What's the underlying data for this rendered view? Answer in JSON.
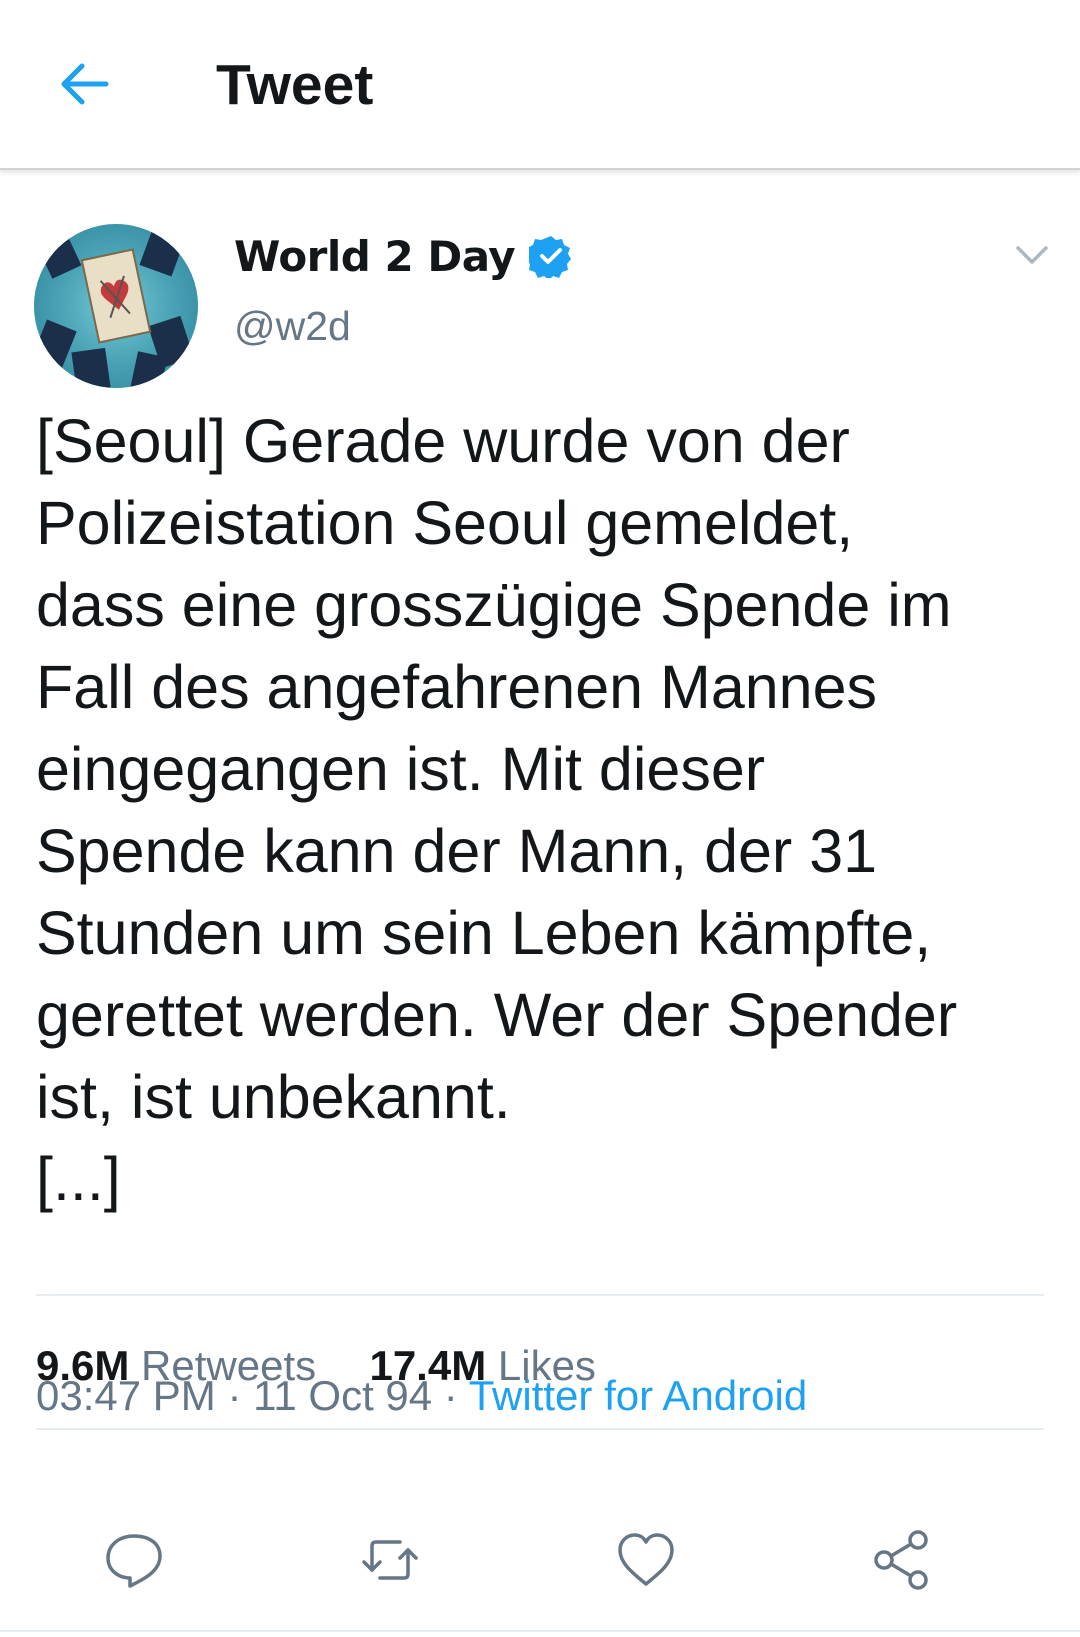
{
  "header": {
    "title": "Tweet",
    "back_icon": "arrow-left-icon"
  },
  "tweet": {
    "author_name": "World 2 Day",
    "author_handle": "@w2d",
    "verified": true,
    "text": "[Seoul] Gerade wurde von der\nPolizeistation Seoul gemeldet,\ndass eine grosszügige Spende im\nFall des angefahrenen Mannes\neingegangen ist. Mit dieser\nSpende kann der Mann, der 31\nStunden um sein Leben kämpfte,\ngerettet werden. Wer der Spender\nist, ist unbekannt.\n[...]",
    "time": "03:47 PM",
    "separator": "·",
    "date": "11 Oct 94",
    "source": "Twitter for Android"
  },
  "stats": {
    "retweets_count": "9.6M",
    "retweets_label": "Retweets",
    "likes_count": "17.4M",
    "likes_label": "Likes"
  },
  "actions": [
    "reply-icon",
    "retweet-icon",
    "like-icon",
    "share-icon"
  ],
  "colors": {
    "accent": "#1da1f2",
    "text": "#14171a",
    "muted": "#657786",
    "divider": "#e6ecf0"
  }
}
